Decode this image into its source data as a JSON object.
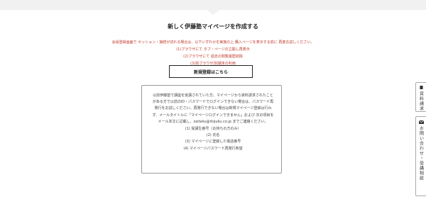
{
  "page": {
    "title": "新しく伊藤塾マイページを作成する"
  },
  "notice": {
    "lines": [
      "会員登録画面で セッション・接続が切れる場合は、以下いずれかを実施の上 購入ページを表示する前に 再度お試しください。",
      "(1)ブラウザにて タブ・ページの立開し再表示",
      "(2)ブラウザにて 過去の閲覧履歴削除",
      "(3)別ブラウザ/別端末の利用"
    ],
    "color": "#c0392b"
  },
  "register_button": {
    "label": "新規登録はこちら"
  },
  "info": {
    "paragraphs": [
      "以前伊藤塾で講座を受講されていた方、マイページから資料請求されたことがある方で以前のID・パスワードでログインできない場合は、パスワード再発行をお試しください。再発行できない場合は新規マイページ登録は行わず、メールタイトルに「マイページログインできません」および 次の項目をメール本文に記載し、zaitaku@itojuku.co.jp までご連絡ください。"
    ],
    "items": [
      "(1) 受講生番号（お持ちの方のみ）",
      "(2) 氏名",
      "(3) マイページに登録した電話番号",
      "(4) マイページパスワード再発行希望"
    ]
  },
  "side_tabs": {
    "brochure_label": "資料請求",
    "contact_label": "お問い合わせ・受講相談",
    "brochure_icon": "document-icon",
    "contact_icon": "mail-icon"
  }
}
